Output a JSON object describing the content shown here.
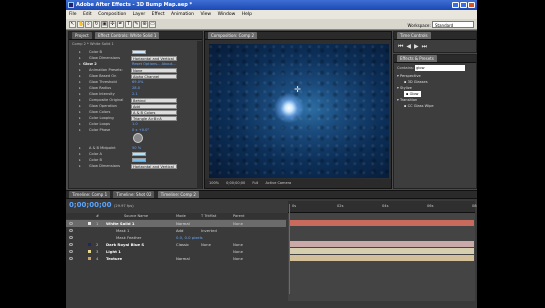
{
  "window": {
    "title": "Adobe After Effects - 3D Bump Map.aep *"
  },
  "menu": [
    "File",
    "Edit",
    "Composition",
    "Layer",
    "Effect",
    "Animation",
    "View",
    "Window",
    "Help"
  ],
  "workspace": {
    "label": "Workspace:",
    "value": "Standard"
  },
  "effect_controls": {
    "tab_project": "Project",
    "tab_effect": "Effect Controls: White Solid 1",
    "subtitle": "Comp 2 * White Solid 1",
    "rows": [
      {
        "label": "Color B",
        "value": ""
      },
      {
        "label": "Glow Dimensions",
        "value": "Horizontal and Vertical"
      },
      {
        "label": "Glow 2",
        "value": "Reset   Options...   About..."
      },
      {
        "label": "Animation Presets:",
        "value": "None"
      },
      {
        "label": "Glow Based On",
        "value": "Alpha Channel"
      },
      {
        "label": "Glow Threshold",
        "value": "69.0%"
      },
      {
        "label": "Glow Radius",
        "value": "28.0"
      },
      {
        "label": "Glow Intensity",
        "value": "2.1"
      },
      {
        "label": "Composite Original",
        "value": "Behind"
      },
      {
        "label": "Glow Operation",
        "value": "Add"
      },
      {
        "label": "Glow Colors",
        "value": "A & B Colors"
      },
      {
        "label": "Color Looping",
        "value": "Triangle A>B>A"
      },
      {
        "label": "Color Loops",
        "value": "1.0"
      },
      {
        "label": "Color Phase",
        "value": "0 x +0.0°"
      },
      {
        "label": "A & B Midpoint",
        "value": "50 %"
      },
      {
        "label": "Color A",
        "value": ""
      },
      {
        "label": "Color B",
        "value": ""
      },
      {
        "label": "Glow Dimensions",
        "value": "Horizontal and Vertical"
      }
    ]
  },
  "composition": {
    "tab": "Composition: Comp 2",
    "zoom": "100%",
    "timecode": "0;00;00;00",
    "resolution": "Full",
    "camera": "Active Camera"
  },
  "time_controls": {
    "tab": "Time Controls"
  },
  "effects_presets": {
    "tab": "Effects & Presets",
    "contains_label": "Contains:",
    "contains_value": "glow",
    "items": [
      "Perspective",
      "3D Glasses",
      "Stylize",
      "Glow",
      "Transition",
      "CC Glass Wipe"
    ]
  },
  "timeline": {
    "tabs": [
      "Timeline: Comp 1",
      "Timeline: Shot 02",
      "Timeline: Comp 2"
    ],
    "timecode": "0;00;00;00",
    "fps": "(29.97 fps)",
    "columns": [
      "#",
      "Source Name",
      "Mode",
      "T TrkMat",
      "Parent"
    ],
    "layers": [
      {
        "num": "1",
        "name": "White Solid 1",
        "mode": "Normal",
        "trkmat": "",
        "parent": "None",
        "color": "#e8e8e8",
        "selected": true
      },
      {
        "num": "",
        "name": "Mask 1",
        "mode": "Add",
        "trkmat": "Inverted",
        "parent": "",
        "color": "",
        "selected": false
      },
      {
        "num": "",
        "name": "Mask Feather",
        "mode": "0.0, 0.0 pixels",
        "trkmat": "",
        "parent": "",
        "color": "",
        "selected": false
      },
      {
        "num": "2",
        "name": "Dark Royal Blue S",
        "mode": "Classic",
        "trkmat": "None",
        "parent": "None",
        "color": "#22285e",
        "selected": false
      },
      {
        "num": "3",
        "name": "Light 1",
        "mode": "",
        "trkmat": "",
        "parent": "None",
        "color": "#e8d890",
        "selected": false
      },
      {
        "num": "4",
        "name": "Texture",
        "mode": "Normal",
        "trkmat": "",
        "parent": "None",
        "color": "#c9a36a",
        "selected": false
      }
    ],
    "ruler": [
      "0s",
      "02s",
      "04s",
      "06s",
      "08s"
    ]
  }
}
